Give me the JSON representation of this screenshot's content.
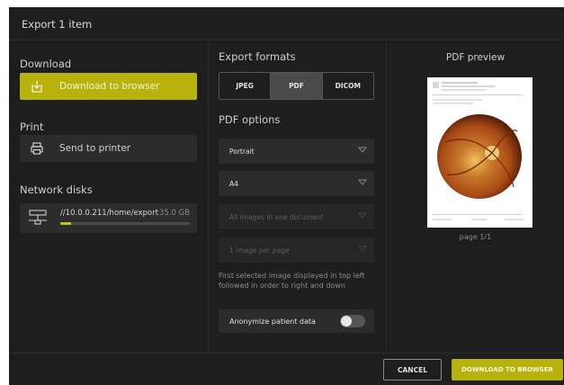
{
  "dialog": {
    "title": "Export 1 item"
  },
  "download": {
    "section_label": "Download",
    "button_label": "Download to browser",
    "button_icon": "download-icon"
  },
  "print": {
    "section_label": "Print",
    "button_label": "Send to printer",
    "button_icon": "printer-icon"
  },
  "network": {
    "section_label": "Network disks",
    "disk": {
      "path": "//10.0.0.211/home/export",
      "size": "35.0 GB",
      "usage_fraction": 0.08,
      "icon": "network-drive-icon"
    }
  },
  "formats": {
    "section_label": "Export formats",
    "options": [
      "JPEG",
      "PDF",
      "DICOM"
    ],
    "selected": "PDF"
  },
  "pdf_options": {
    "section_label": "PDF options",
    "orientation": "Portrait",
    "paper_size": "A4",
    "grouping": "All images in one document",
    "layout": "1 image per page",
    "info_text": "First selected image displayed in top left followed in order to right and down",
    "anonymize_label": "Anonymize patient data",
    "anonymize_on": false
  },
  "preview": {
    "title": "PDF preview",
    "page_label": "page 1/1"
  },
  "footer": {
    "cancel_label": "CANCEL",
    "download_label": "DOWNLOAD TO BROWSER"
  },
  "colors": {
    "accent": "#b7b30c",
    "background": "#1e1e1e",
    "panel": "#2c2c2c"
  }
}
